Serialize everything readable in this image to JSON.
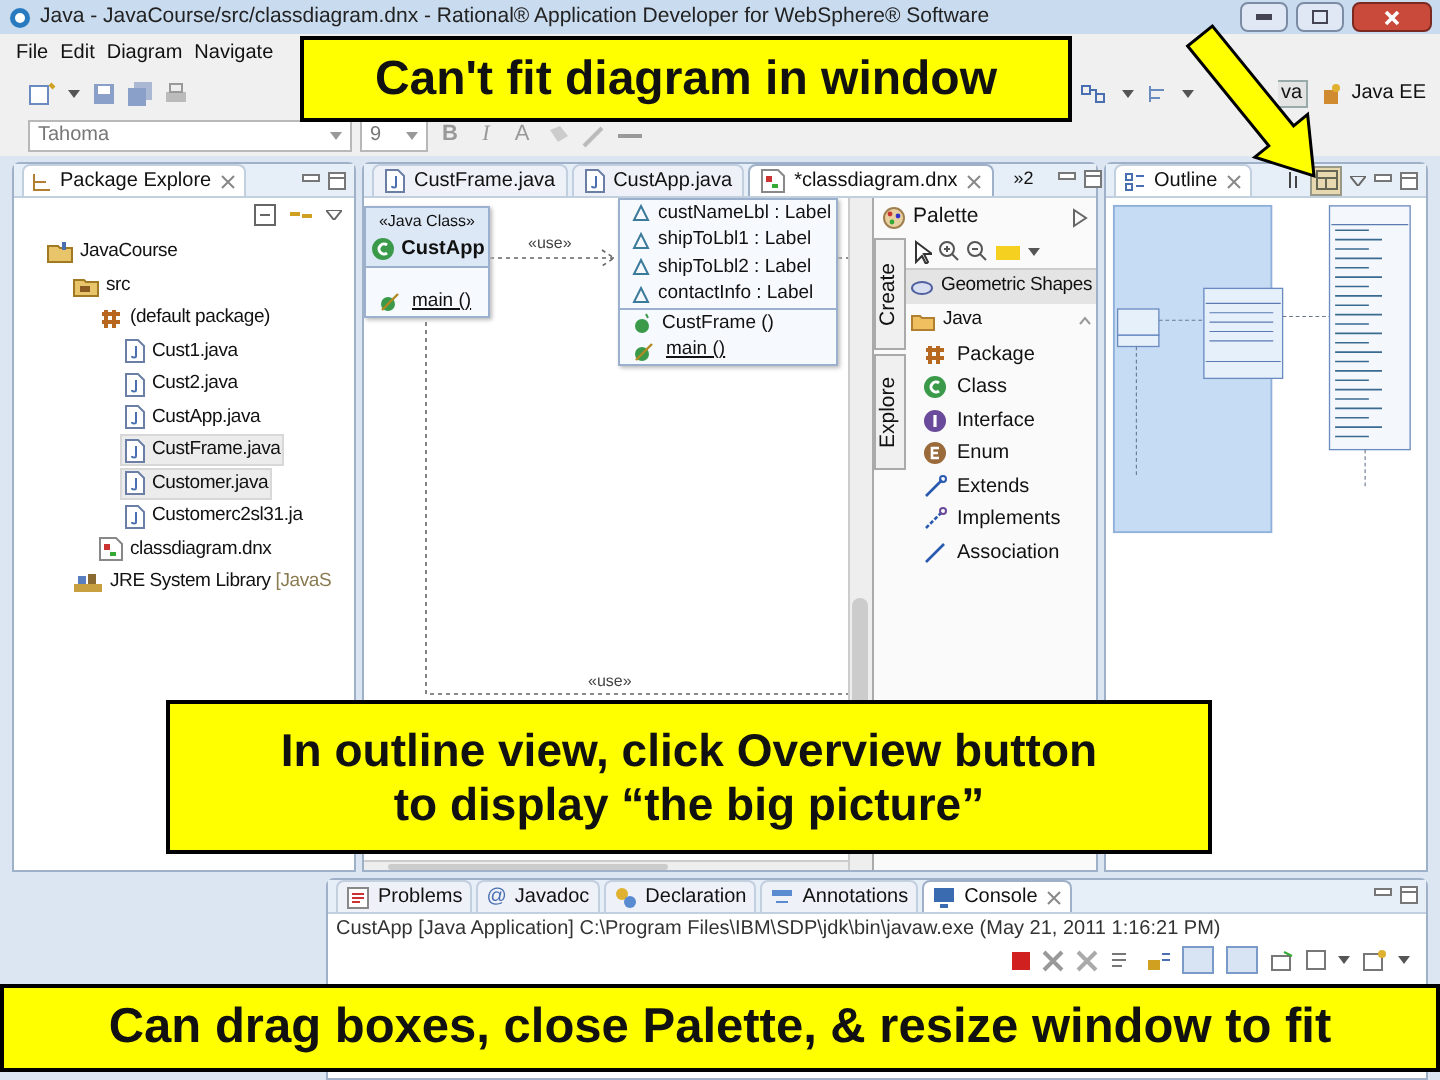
{
  "window": {
    "title": "Java - JavaCourse/src/classdiagram.dnx - Rational® Application Developer for WebSphere® Software"
  },
  "menu": [
    "File",
    "Edit",
    "Diagram",
    "Navigate"
  ],
  "perspectives": [
    {
      "label": "va",
      "selected": true
    },
    {
      "label": "Java EE",
      "selected": false
    }
  ],
  "font_bar": {
    "font": "Tahoma",
    "size": "9",
    "format_buttons": [
      "B",
      "I",
      "A"
    ]
  },
  "package_explorer": {
    "title": "Package Explore",
    "tree": [
      {
        "label": "JavaCourse",
        "kind": "project",
        "selected": false,
        "children": [
          {
            "label": "src",
            "kind": "folder",
            "selected": false,
            "children": [
              {
                "label": "(default package)",
                "kind": "package",
                "selected": false,
                "children": [
                  {
                    "label": "Cust1.java",
                    "kind": "java",
                    "selected": false
                  },
                  {
                    "label": "Cust2.java",
                    "kind": "java",
                    "selected": false
                  },
                  {
                    "label": "CustApp.java",
                    "kind": "java",
                    "selected": false
                  },
                  {
                    "label": "CustFrame.java",
                    "kind": "java",
                    "selected": true
                  },
                  {
                    "label": "Customer.java",
                    "kind": "java",
                    "selected": true
                  },
                  {
                    "label": "Customerc2sl31.ja",
                    "kind": "java",
                    "selected": false
                  }
                ]
              },
              {
                "label": "classdiagram.dnx",
                "kind": "diagram",
                "selected": false
              }
            ]
          },
          {
            "label": "JRE System Library",
            "detail": "[JavaS",
            "kind": "library",
            "selected": false
          }
        ]
      }
    ]
  },
  "editor": {
    "tabs": [
      {
        "label": "CustFrame.java",
        "selected": false
      },
      {
        "label": "CustApp.java",
        "selected": false
      },
      {
        "label": "*classdiagram.dnx",
        "selected": true
      }
    ],
    "overflow": "»2",
    "diagram": {
      "classes": [
        {
          "stereotype": "«Java Class»",
          "name": "CustApp",
          "members": [
            {
              "label": "main ()",
              "kind": "static_method"
            }
          ]
        },
        {
          "members": [
            {
              "label": "custNameLbl : Label",
              "kind": "field"
            },
            {
              "label": "shipToLbl1 : Label",
              "kind": "field"
            },
            {
              "label": "shipToLbl2 : Label",
              "kind": "field"
            },
            {
              "label": "contactInfo : Label",
              "kind": "field"
            },
            {
              "label": "CustFrame ()",
              "kind": "constructor"
            },
            {
              "label": "main ()",
              "kind": "static_method"
            }
          ]
        }
      ],
      "edge_labels": [
        "«use»",
        "«use»"
      ]
    }
  },
  "palette": {
    "title": "Palette",
    "drawers": [
      "Create",
      "Explore"
    ],
    "sections": [
      {
        "label": "Geometric Shapes",
        "expanded": false
      },
      {
        "label": "Java",
        "expanded": true
      }
    ],
    "tools": [
      {
        "label": "Package",
        "kind": "package"
      },
      {
        "label": "Class",
        "kind": "class"
      },
      {
        "label": "Interface",
        "kind": "interface"
      },
      {
        "label": "Enum",
        "kind": "enum"
      },
      {
        "label": "Extends",
        "kind": "extends"
      },
      {
        "label": "Implements",
        "kind": "implements"
      },
      {
        "label": "Association",
        "kind": "association"
      }
    ]
  },
  "outline": {
    "title": "Outline"
  },
  "bottom_panel": {
    "tabs": [
      {
        "label": "Problems",
        "kind": "problems",
        "selected": false
      },
      {
        "label": "Javadoc",
        "kind": "javadoc",
        "glyph": "@",
        "selected": false
      },
      {
        "label": "Declaration",
        "kind": "declaration",
        "selected": false
      },
      {
        "label": "Annotations",
        "kind": "annotations",
        "selected": false
      },
      {
        "label": "Console",
        "kind": "console",
        "selected": true
      }
    ],
    "console_line": "CustApp [Java Application] C:\\Program Files\\IBM\\SDP\\jdk\\bin\\javaw.exe (May 21, 2011 1:16:21 PM)"
  },
  "callouts": [
    {
      "kind": "top",
      "lines": [
        "Can't fit diagram in window"
      ]
    },
    {
      "kind": "middle",
      "lines": [
        "In outline view, click Overview button",
        "to display “the big picture”"
      ]
    },
    {
      "kind": "bottom",
      "lines": [
        "Can drag boxes, close Palette, & resize window to fit"
      ]
    }
  ]
}
